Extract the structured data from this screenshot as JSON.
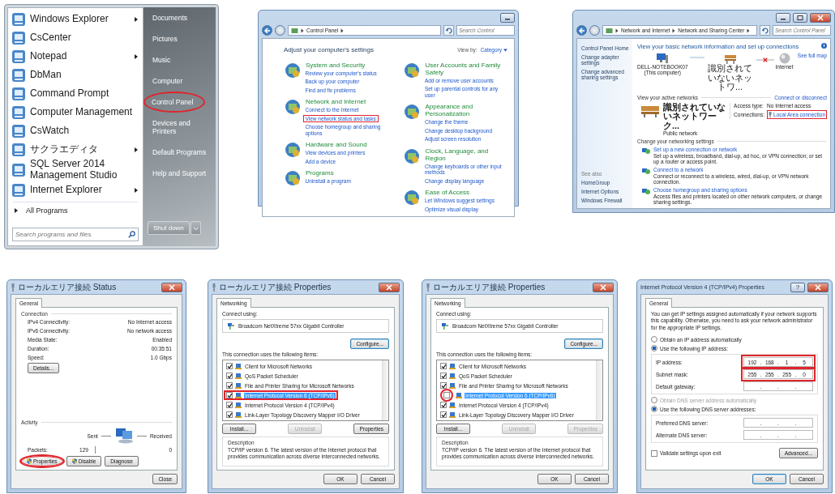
{
  "panels": [
    {
      "kind": "start_menu",
      "programs": [
        {
          "label": "Windows Explorer",
          "submenu": true
        },
        {
          "label": "CsCenter",
          "submenu": false
        },
        {
          "label": "Notepad",
          "submenu": true
        },
        {
          "label": "DbMan",
          "submenu": false
        },
        {
          "label": "Command Prompt",
          "submenu": false
        },
        {
          "label": "Computer Management",
          "submenu": false
        },
        {
          "label": "CsWatch",
          "submenu": false
        },
        {
          "label": "サクラエディタ",
          "submenu": true
        },
        {
          "label": "SQL Server 2014 Management Studio",
          "submenu": false
        },
        {
          "label": "Internet Explorer",
          "submenu": true
        }
      ],
      "all_programs": "All Programs",
      "search": {
        "placeholder": "Search programs and files"
      },
      "places": [
        {
          "label": "Documents",
          "highlighted": false
        },
        {
          "label": "Pictures",
          "highlighted": false
        },
        {
          "label": "Music",
          "highlighted": false
        },
        {
          "label": "Computer",
          "highlighted": false
        },
        {
          "label": "Control Panel",
          "highlighted": true
        },
        {
          "label": "Devices and Printers",
          "highlighted": false
        },
        {
          "label": "Default Programs",
          "highlighted": false
        },
        {
          "label": "Help and Support",
          "highlighted": false
        }
      ],
      "shutdown": "Shut down"
    },
    {
      "kind": "control_panel",
      "breadcrumbs": [
        "Control Panel"
      ],
      "search": {
        "placeholder": "Search Control"
      },
      "heading": "Adjust your computer's settings",
      "view_by_label": "View by:",
      "view_by_value": "Category",
      "columns": [
        [
          {
            "title": "System and Security",
            "links": [
              {
                "text": "Review your computer's status",
                "highlighted": false
              },
              {
                "text": "Back up your computer",
                "highlighted": false
              },
              {
                "text": "Find and fix problems",
                "highlighted": false
              }
            ]
          },
          {
            "title": "Network and Internet",
            "links": [
              {
                "text": "Connect to the Internet",
                "highlighted": false
              },
              {
                "text": "View network status and tasks",
                "highlighted": true
              },
              {
                "text": "Choose homegroup and sharing options",
                "highlighted": false
              }
            ]
          },
          {
            "title": "Hardware and Sound",
            "links": [
              {
                "text": "View devices and printers",
                "highlighted": false
              },
              {
                "text": "Add a device",
                "highlighted": false
              }
            ]
          },
          {
            "title": "Programs",
            "links": [
              {
                "text": "Uninstall a program",
                "highlighted": false
              }
            ]
          }
        ],
        [
          {
            "title": "User Accounts and Family Safety",
            "links": [
              {
                "text": "Add or remove user accounts",
                "highlighted": false
              },
              {
                "text": "Set up parental controls for any user",
                "highlighted": false
              }
            ]
          },
          {
            "title": "Appearance and Personalization",
            "links": [
              {
                "text": "Change the theme",
                "highlighted": false
              },
              {
                "text": "Change desktop background",
                "highlighted": false
              },
              {
                "text": "Adjust screen resolution",
                "highlighted": false
              }
            ]
          },
          {
            "title": "Clock, Language, and Region",
            "links": [
              {
                "text": "Change keyboards or other input methods",
                "highlighted": false
              },
              {
                "text": "Change display language",
                "highlighted": false
              }
            ]
          },
          {
            "title": "Ease of Access",
            "links": [
              {
                "text": "Let Windows suggest settings",
                "highlighted": false
              },
              {
                "text": "Optimize visual display",
                "highlighted": false
              }
            ]
          }
        ]
      ]
    },
    {
      "kind": "network_center",
      "breadcrumbs": [
        "Network and Internet",
        "Network and Sharing Center"
      ],
      "search": {
        "placeholder": "Search Control Panel"
      },
      "sidebar": [
        "Control Panel Home",
        "Change adapter settings",
        "Change advanced sharing settings"
      ],
      "see_also_label": "See also",
      "see_also": [
        "HomeGroup",
        "Internet Options",
        "Windows Firewall"
      ],
      "heading": "View your basic network information and set up connections",
      "see_full_map": "See full map",
      "computer_name": "DELL-NOTEBOOK07",
      "computer_note": "(This computer)",
      "network_name": "識別されていないネットワ...",
      "internet": "Internet",
      "map_links": [
        {
          "broken": false
        },
        {
          "broken": true
        }
      ],
      "active_label": "View your active networks",
      "connect_link": "Connect or disconnect",
      "active_network": {
        "name": "識別されていないネットワーク...",
        "type": "Public network",
        "access_label": "Access type:",
        "access": "No Internet access",
        "connections_label": "Connections:",
        "connection": "Local Area connection",
        "highlighted": true
      },
      "settings_label": "Change your networking settings",
      "tasks": [
        {
          "title": "Set up a new connection or network",
          "desc": "Set up a wireless, broadband, dial-up, ad hoc, or VPN connection; or set up a router or access point."
        },
        {
          "title": "Connect to a network",
          "desc": "Connect or reconnect to a wireless, wired, dial-up, or VPN network connection."
        },
        {
          "title": "Choose homegroup and sharing options",
          "desc": "Access files and printers located on other network computers, or change sharing settings."
        }
      ]
    },
    {
      "kind": "status_dialog",
      "title": "ローカルエリア接続 Status",
      "tab": "General",
      "connection_label": "Connection",
      "rows": [
        {
          "label": "IPv4 Connectivity:",
          "value": "No Internet access"
        },
        {
          "label": "IPv6 Connectivity:",
          "value": "No network access"
        },
        {
          "label": "Media State:",
          "value": "Enabled"
        },
        {
          "label": "Duration:",
          "value": "00:35:51"
        },
        {
          "label": "Speed:",
          "value": "1.0 Gbps"
        }
      ],
      "details": "Details...",
      "activity_label": "Activity",
      "sent": "Sent",
      "received": "Received",
      "packets_label": "Packets:",
      "packets_sent": "129",
      "packets_received": "0",
      "buttons": [
        {
          "label": "Properties",
          "highlighted": true
        },
        {
          "label": "Disable",
          "highlighted": false
        },
        {
          "label": "Diagnose",
          "highlighted": false
        }
      ],
      "close": "Close"
    },
    {
      "kind": "properties_dialog",
      "title": "ローカルエリア接続 Properties",
      "tab": "Networking",
      "connect_label": "Connect using:",
      "adapter": "Broadcom NetXtreme 57xx Gigabit Controller",
      "configure": "Configure...",
      "items_label": "This connection uses the following items:",
      "items": [
        {
          "label": "Client for Microsoft Networks",
          "checked": true,
          "selected": false,
          "row_boxed": false,
          "checkbox_circled": false
        },
        {
          "label": "QoS Packet Scheduler",
          "checked": true,
          "selected": false,
          "row_boxed": false,
          "checkbox_circled": false
        },
        {
          "label": "File and Printer Sharing for Microsoft Networks",
          "checked": true,
          "selected": false,
          "row_boxed": false,
          "checkbox_circled": false
        },
        {
          "label": "Internet Protocol Version 6 (TCP/IPv6)",
          "checked": true,
          "selected": true,
          "row_boxed": true,
          "checkbox_circled": false
        },
        {
          "label": "Internet Protocol Version 4 (TCP/IPv4)",
          "checked": true,
          "selected": false,
          "row_boxed": false,
          "checkbox_circled": false
        },
        {
          "label": "Link-Layer Topology Discovery Mapper I/O Driver",
          "checked": true,
          "selected": false,
          "row_boxed": false,
          "checkbox_circled": false
        }
      ],
      "buttons": [
        {
          "label": "Install...",
          "disabled": false
        },
        {
          "label": "Uninstall",
          "disabled": true
        },
        {
          "label": "Properties",
          "disabled": false
        }
      ],
      "description_label": "Description",
      "description": "TCP/IP version 6. The latest version of the Internet protocol that provides communication across diverse interconnected networks.",
      "ok": "OK",
      "cancel": "Cancel"
    },
    {
      "kind": "properties_dialog",
      "title": "ローカルエリア接続 Properties",
      "tab": "Networking",
      "connect_label": "Connect using:",
      "adapter": "Broadcom NetXtreme 57xx Gigabit Controller",
      "configure": "Configure...",
      "items_label": "This connection uses the following items:",
      "items": [
        {
          "label": "Client for Microsoft Networks",
          "checked": true,
          "selected": false,
          "row_boxed": false,
          "checkbox_circled": false
        },
        {
          "label": "QoS Packet Scheduler",
          "checked": true,
          "selected": false,
          "row_boxed": false,
          "checkbox_circled": false
        },
        {
          "label": "File and Printer Sharing for Microsoft Networks",
          "checked": true,
          "selected": false,
          "row_boxed": false,
          "checkbox_circled": false
        },
        {
          "label": "Internet Protocol Version 6 (TCP/IPv6)",
          "checked": false,
          "selected": true,
          "row_boxed": false,
          "checkbox_circled": true
        },
        {
          "label": "Internet Protocol Version 4 (TCP/IPv4)",
          "checked": true,
          "selected": false,
          "row_boxed": false,
          "checkbox_circled": false
        },
        {
          "label": "Link-Layer Topology Discovery Mapper I/O Driver",
          "checked": true,
          "selected": false,
          "row_boxed": false,
          "checkbox_circled": false
        }
      ],
      "buttons": [
        {
          "label": "Install...",
          "disabled": false
        },
        {
          "label": "Uninstall",
          "disabled": true
        },
        {
          "label": "Properties",
          "disabled": true
        }
      ],
      "description_label": "Description",
      "description": "TCP/IP version 6. The latest version of the Internet protocol that provides communication across diverse interconnected networks.",
      "ok": "OK",
      "cancel": "Cancel"
    },
    {
      "kind": "ipv4_dialog",
      "title": "Internet Protocol Version 4 (TCP/IPv4) Properties",
      "help": "?",
      "tab": "General",
      "intro": "You can get IP settings assigned automatically if your network supports this capability. Otherwise, you need to ask your network administrator for the appropriate IP settings.",
      "separator": ".",
      "ip_radios": [
        {
          "label": "Obtain an IP address automatically",
          "selected": false,
          "disabled": false
        },
        {
          "label": "Use the following IP address:",
          "selected": true,
          "disabled": false
        }
      ],
      "ip_fields": [
        {
          "label": "IP address:",
          "segments": [
            "192",
            "168",
            "1",
            "5"
          ],
          "highlighted": true
        },
        {
          "label": "Subnet mask:",
          "segments": [
            "255",
            "255",
            "255",
            "0"
          ],
          "highlighted": true
        },
        {
          "label": "Default gateway:",
          "highlighted": false
        }
      ],
      "dns_radios": [
        {
          "label": "Obtain DNS server address automatically",
          "selected": false,
          "disabled": true
        },
        {
          "label": "Use the following DNS server addresses:",
          "selected": true,
          "disabled": false
        }
      ],
      "dns_fields": [
        {
          "label": "Preferred DNS server:",
          "highlighted": false
        },
        {
          "label": "Alternate DNS server:",
          "highlighted": false
        }
      ],
      "validate": {
        "label": "Validate settings upon exit",
        "checked": false
      },
      "advanced": "Advanced...",
      "ok": "OK",
      "cancel": "Cancel"
    }
  ]
}
